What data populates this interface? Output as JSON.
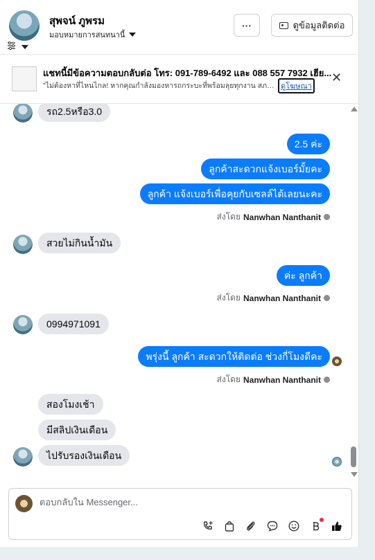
{
  "header": {
    "name": "สุพจน์ ภูพรม",
    "assignee": "มอบหมายการสนทนานี้",
    "more_label": "···",
    "contact_button": "ดูข้อมูลติดต่อ"
  },
  "ad": {
    "title": "แชทนี้มีข้อความตอบกลับต่อ โทร: 091-789-6492 และ 088 557 7932 เฮีย...",
    "text": "\"ไม่ต้องหาที่ไหนไกล! หากคุณกำลังมองหารถกระบะที่พร้อมลุยทุกงาน สภา...",
    "link": "ดูโฆษณา"
  },
  "messages": {
    "m1": "รถ2.5หรือ3.0",
    "m2": "2.5 ค่ะ",
    "m3": "ลูกค้าสะดวกแจ้งเบอร์มั้ยคะ",
    "m4": "ลูกค้า แจ้งเบอร์เพื่อคุยกับเซลล์ได้เลยนะคะ",
    "m5": "สวยไม่กินน้ำมัน",
    "m6": "ค่ะ  ลูกค้า",
    "m7": "0994971091",
    "m8": "พรุ่งนี้ ลูกค้า สะดวกให้ติดต่อ ช่วงกี่โมงดีคะ",
    "m9": "สองโมงเช้า",
    "m10": "มีสลิปเงินเดือน",
    "m11": "ไปรับรองเงินเดือน"
  },
  "sent_by": {
    "prefix": "ส่งโดย",
    "name": "Nanwhan Nanthanit"
  },
  "composer": {
    "placeholder": "ตอบกลับใน Messenger..."
  },
  "colors": {
    "accent": "#0a7cff",
    "incoming_bubble": "#e4e6eb"
  }
}
